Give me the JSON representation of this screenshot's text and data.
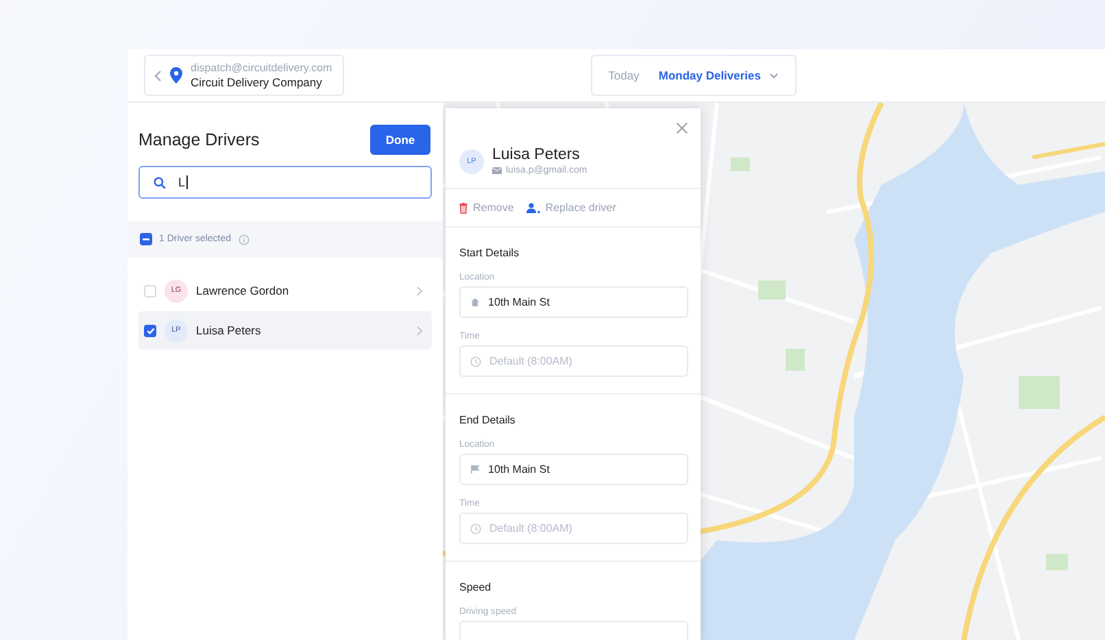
{
  "account": {
    "email": "dispatch@circuitdelivery.com",
    "company": "Circuit Delivery Company"
  },
  "date_switcher": {
    "items": [
      {
        "label": "Today",
        "selected": false
      },
      {
        "label": "Monday Deliveries",
        "selected": true
      }
    ]
  },
  "manage_drivers": {
    "title": "Manage Drivers",
    "done_button": "Done",
    "search": {
      "value": "L"
    },
    "selection": {
      "label": "1 Driver selected",
      "indeterminate": true
    },
    "drivers": [
      {
        "initials": "LG",
        "name": "Lawrence Gordon",
        "checked": false,
        "selected": false,
        "color": "#fbe3ea"
      },
      {
        "initials": "LP",
        "name": "Luisa Peters",
        "checked": true,
        "selected": true,
        "color": "#e3ebfb"
      }
    ]
  },
  "driver_details": {
    "initials": "LP",
    "name": "Luisa Peters",
    "email": "luisa.p@gmail.com",
    "actions": [
      {
        "kind": "remove",
        "label": "Remove"
      },
      {
        "kind": "replace",
        "label": "Replace driver"
      }
    ],
    "sections": [
      {
        "kind": "start",
        "title": "Start Details",
        "fields": [
          {
            "kind": "location",
            "label": "Location",
            "value": "10th Main St"
          },
          {
            "kind": "time",
            "label": "Time",
            "placeholder": "Default (8:00AM)"
          }
        ]
      },
      {
        "kind": "end",
        "title": "End Details",
        "fields": [
          {
            "kind": "location",
            "label": "Location",
            "value": "10th Main St"
          },
          {
            "kind": "time",
            "label": "Time",
            "placeholder": "Default (8:00AM)"
          }
        ]
      },
      {
        "kind": "speed",
        "title": "Speed",
        "fields": [
          {
            "kind": "speed",
            "label": "Driving speed"
          }
        ]
      }
    ]
  }
}
